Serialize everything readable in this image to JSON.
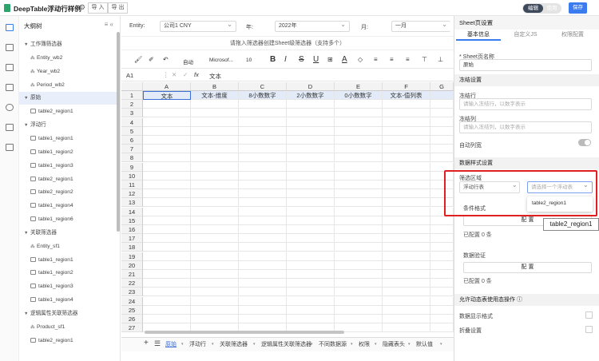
{
  "header": {
    "title": "DeepTable浮动行样例",
    "import_label": "导 入",
    "export_label": "导 出",
    "mode_edit": "编辑",
    "mode_use": "使用",
    "save_label": "保存"
  },
  "tree": {
    "title": "大纲树",
    "items": [
      {
        "label": "工作簿筛选器",
        "type": "group"
      },
      {
        "label": "Entity_wb2",
        "type": "leaf"
      },
      {
        "label": "Year_wb2",
        "type": "leaf"
      },
      {
        "label": "Period_wb2",
        "type": "leaf"
      },
      {
        "label": "原始",
        "type": "group",
        "selected": true
      },
      {
        "label": "table2_region1",
        "type": "table"
      },
      {
        "label": "浮动行",
        "type": "group"
      },
      {
        "label": "table1_region1",
        "type": "table"
      },
      {
        "label": "table1_region2",
        "type": "table"
      },
      {
        "label": "table1_region3",
        "type": "table"
      },
      {
        "label": "table2_region1",
        "type": "table"
      },
      {
        "label": "table2_region2",
        "type": "table"
      },
      {
        "label": "table1_region4",
        "type": "table"
      },
      {
        "label": "table1_region6",
        "type": "table"
      },
      {
        "label": "关联筛选器",
        "type": "group"
      },
      {
        "label": "Entity_sf1",
        "type": "leaf"
      },
      {
        "label": "table1_region1",
        "type": "table"
      },
      {
        "label": "table1_region2",
        "type": "table"
      },
      {
        "label": "table1_region3",
        "type": "table"
      },
      {
        "label": "table1_region4",
        "type": "table"
      },
      {
        "label": "逻辑属性关联筛选器",
        "type": "group"
      },
      {
        "label": "Product_sf1",
        "type": "leaf"
      },
      {
        "label": "table2_region1",
        "type": "table"
      }
    ]
  },
  "filters": {
    "entity_label": "Entity:",
    "entity_value": "公司1 CNY",
    "year_label": "年:",
    "year_value": "2022年",
    "month_label": "月:",
    "month_value": "一月"
  },
  "hint": "请拖入筛选器创建Sheet级筛选器（支持多个）",
  "toolbar": {
    "font_size_mode": "自动",
    "font_name": "Microsof...",
    "font_size": "10"
  },
  "formula": {
    "cell_ref": "A1",
    "fx": "fx",
    "content": "文本"
  },
  "grid": {
    "columns": [
      "A",
      "B",
      "C",
      "D",
      "E",
      "F",
      "G"
    ],
    "rows": [
      "1",
      "2",
      "3",
      "4",
      "5",
      "6",
      "7",
      "8",
      "9",
      "10",
      "11",
      "12",
      "13",
      "14",
      "15",
      "16",
      "17",
      "18",
      "19",
      "20",
      "21",
      "22",
      "23",
      "24",
      "25",
      "26",
      "27"
    ],
    "row1": [
      "文本",
      "文本-维度",
      "8小数数字",
      "2小数数字",
      "0小数数字",
      "文本-值列表",
      ""
    ]
  },
  "sheet_tabs": [
    "原始",
    "浮动行",
    "关联筛选器",
    "逻辑属性关联筛选器",
    "不同数据源",
    "权限",
    "隐藏表头",
    "默认值"
  ],
  "panel": {
    "title": "Sheet页设置",
    "tabs": [
      "基本信息",
      "自定义JS",
      "权限配置"
    ],
    "sheet_name_label": "* Sheet页名称",
    "sheet_name_value": "原始",
    "freeze_section": "冻结设置",
    "freeze_row_label": "冻结行",
    "freeze_row_placeholder": "请输入冻结行，以数字表示",
    "freeze_col_label": "冻结列",
    "freeze_col_placeholder": "请输入冻结列，以数字表示",
    "auto_wrap_label": "自动列宽",
    "data_style_section": "数据样式设置",
    "filter_area_label": "筛选区域",
    "filter_area_value": "浮动行表",
    "region_placeholder": "请选择一个浮动表",
    "dropdown_option": "table2_region1",
    "cond_format_label": "条件格式",
    "config_button": "配 置",
    "configured_count": "已配置 0 条",
    "data_validation_label": "数据验证",
    "config_button2": "配 置",
    "configured_count2": "已配置 0 条",
    "allow_dynamic_section": "允许动态表使用态操作",
    "data_show_format": "数据显示格式",
    "fold_setting": "折叠设置"
  },
  "tooltip": "table2_region1"
}
